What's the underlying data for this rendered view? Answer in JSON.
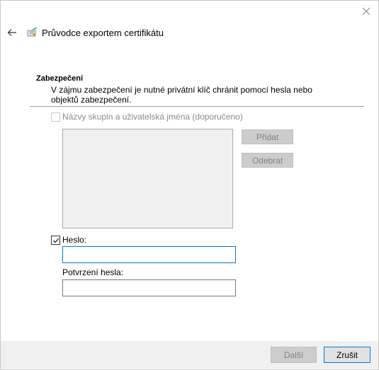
{
  "window": {
    "title": "Průvodce exportem certifikátu",
    "close_icon": "close-icon",
    "back_icon": "back-arrow-icon",
    "title_icon": "certificate-icon"
  },
  "section": {
    "title": "Zabezpečení",
    "description": "V zájmu zabezpečení je nutné privátní klíč chránit pomocí hesla nebo objektů zabezpečení."
  },
  "groups": {
    "checkbox_label": "Názvy skupin a uživatelská jména (doporučeno)",
    "checked": false,
    "enabled": false,
    "add_label": "Přidat",
    "remove_label": "Odebrat"
  },
  "password": {
    "checkbox_label": "Heslo:",
    "checked": true,
    "value": "",
    "confirm_label": "Potvrzení hesla:",
    "confirm_value": ""
  },
  "footer": {
    "next_label": "Další",
    "cancel_label": "Zrušit"
  },
  "colors": {
    "accent": "#0078d7",
    "disabled_button": "#cccccc",
    "footer_bg": "#f0f0f0"
  }
}
